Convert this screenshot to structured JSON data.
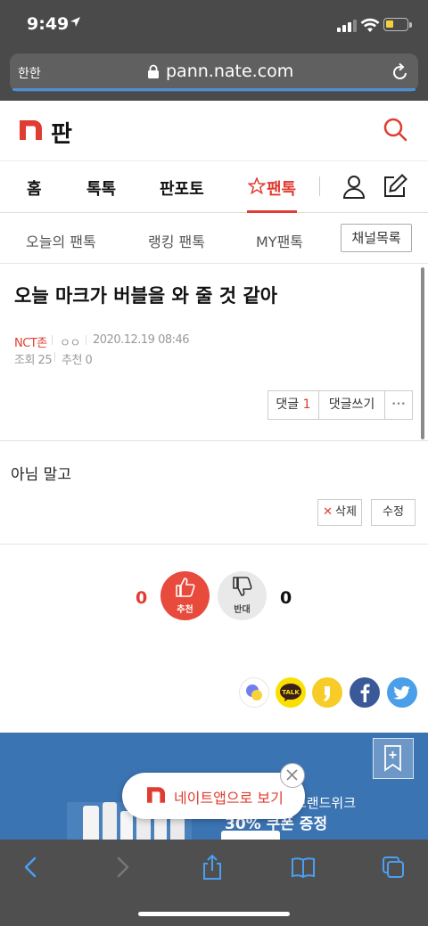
{
  "status_bar": {
    "time": "9:49",
    "location_icon": "location-arrow-icon"
  },
  "browser": {
    "aa_label": "한한",
    "url": "pann.nate.com"
  },
  "header": {
    "logo_text": "판"
  },
  "main_nav": {
    "items": [
      "홈",
      "톡톡",
      "판포토",
      "팬톡"
    ]
  },
  "sub_nav": {
    "items": [
      "오늘의 팬톡",
      "랭킹 팬톡",
      "MY팬톡"
    ],
    "channel_button": "채널목록"
  },
  "post": {
    "title": "오늘 마크가 버블을 와 줄 것 같아",
    "category": "NCT존",
    "author": "ㅇㅇ",
    "date": "2020.12.19 08:46",
    "views_label": "조회 25",
    "recommend_label": "추천 0",
    "comment_label": "댓글",
    "comment_count": "1",
    "write_comment_label": "댓글쓰기",
    "more_label": "•••",
    "body": "아님 말고",
    "delete_label": "삭제",
    "edit_label": "수정"
  },
  "votes": {
    "up_count": "0",
    "up_label": "추천",
    "down_count": "0",
    "down_label": "반대"
  },
  "ad": {
    "line1": "브랜드위크",
    "line2": "30% 쿠폰 증정"
  },
  "app_popup": {
    "text": "네이트앱으로 보기"
  },
  "colors": {
    "accent": "#e03c31",
    "ad_bg": "#3b74b3",
    "chrome": "#4a4a4a"
  }
}
